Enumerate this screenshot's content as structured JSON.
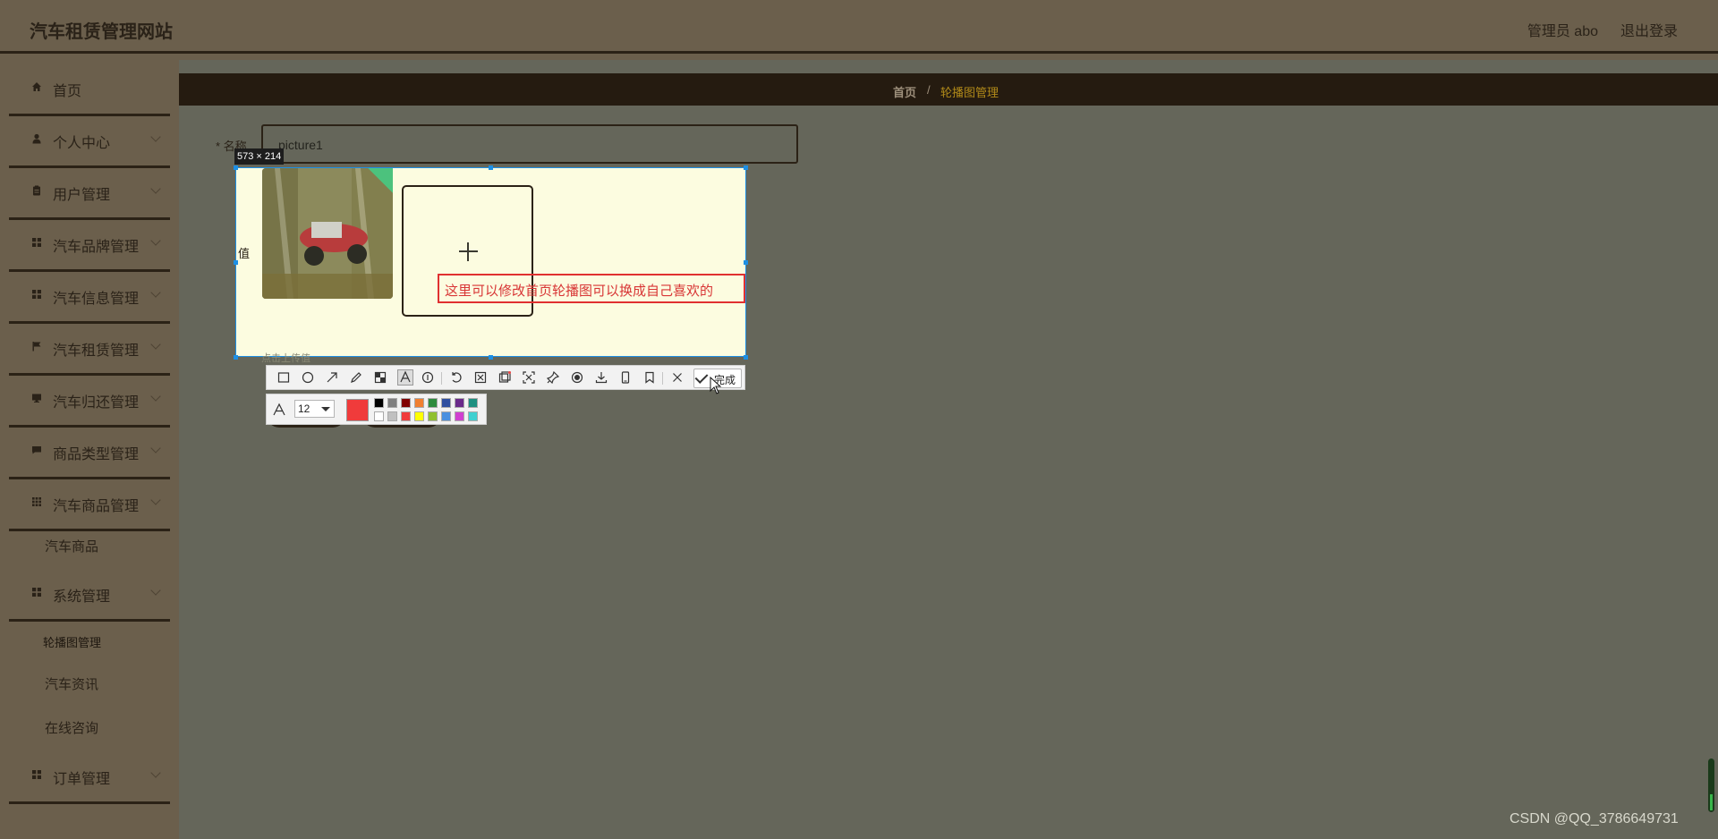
{
  "header": {
    "title": "汽车租赁管理网站",
    "user": "管理员 abo",
    "logout": "退出登录"
  },
  "sidebar": {
    "items": [
      {
        "label": "首页",
        "icon": "home-icon"
      },
      {
        "label": "个人中心",
        "icon": "user-icon"
      },
      {
        "label": "用户管理",
        "icon": "clipboard-icon"
      },
      {
        "label": "汽车品牌管理",
        "icon": "grid-icon"
      },
      {
        "label": "汽车信息管理",
        "icon": "grid-icon"
      },
      {
        "label": "汽车租赁管理",
        "icon": "flag-icon"
      },
      {
        "label": "汽车归还管理",
        "icon": "monitor-icon"
      },
      {
        "label": "商品类型管理",
        "icon": "message-icon"
      },
      {
        "label": "汽车商品管理",
        "icon": "apps-icon"
      },
      {
        "label": "系统管理",
        "icon": "grid-icon"
      },
      {
        "label": "订单管理",
        "icon": "grid-icon"
      }
    ],
    "sub_goods": "汽车商品",
    "sub_carousel": "轮播图管理",
    "sub_news": "汽车资讯",
    "sub_consult": "在线咨询"
  },
  "breadcrumb": {
    "home": "首页",
    "separator": "/",
    "current": "轮播图管理"
  },
  "form": {
    "name_label": "* 名称",
    "name_value": "picture1",
    "value_label": "值",
    "upload_hint": "点击上传值"
  },
  "screenshot_tool": {
    "dimensions": "573 × 214",
    "annotation_text": "这里可以修改首页轮播图可以换成自己喜欢的",
    "done_label": "完成",
    "font_size": "12",
    "current_color": "#f03b3b",
    "palette": [
      "#000000",
      "#808080",
      "#800000",
      "#f08030",
      "#2e8b3e",
      "#2f4fa0",
      "#6a2a8a",
      "#1e9080",
      "#ffffff",
      "#c0c0c0",
      "#f03b3b",
      "#ffff00",
      "#90c030",
      "#4a90e0",
      "#d040d0",
      "#40d0d0"
    ]
  },
  "watermark": "CSDN @QQ_3786649731",
  "colors": {
    "page_bg": "#65665a",
    "sidebar_bg": "#6b5f4c",
    "breadcrumb_bg": "#251b10",
    "accent": "#b18a19",
    "selection": "#1d8fe4"
  }
}
